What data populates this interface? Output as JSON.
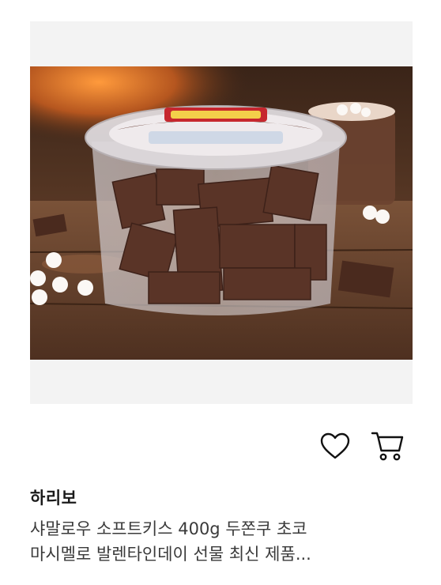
{
  "product": {
    "image_icon": "product-photo-chocolate-marshmallow-tub",
    "brand": "하리보",
    "title_lines": [
      "샤말로우 소프트키스 400g 두쫀쿠 초코",
      "마시멜로 발렌타인데이 선물 최신 제품..."
    ],
    "wishlist_icon": "heart-icon",
    "cart_icon": "cart-icon"
  },
  "colors": {
    "background": "#ffffff",
    "image_frame": "#f3f3f3",
    "icon_stroke": "#111111",
    "title_text": "#3a3a3a"
  }
}
